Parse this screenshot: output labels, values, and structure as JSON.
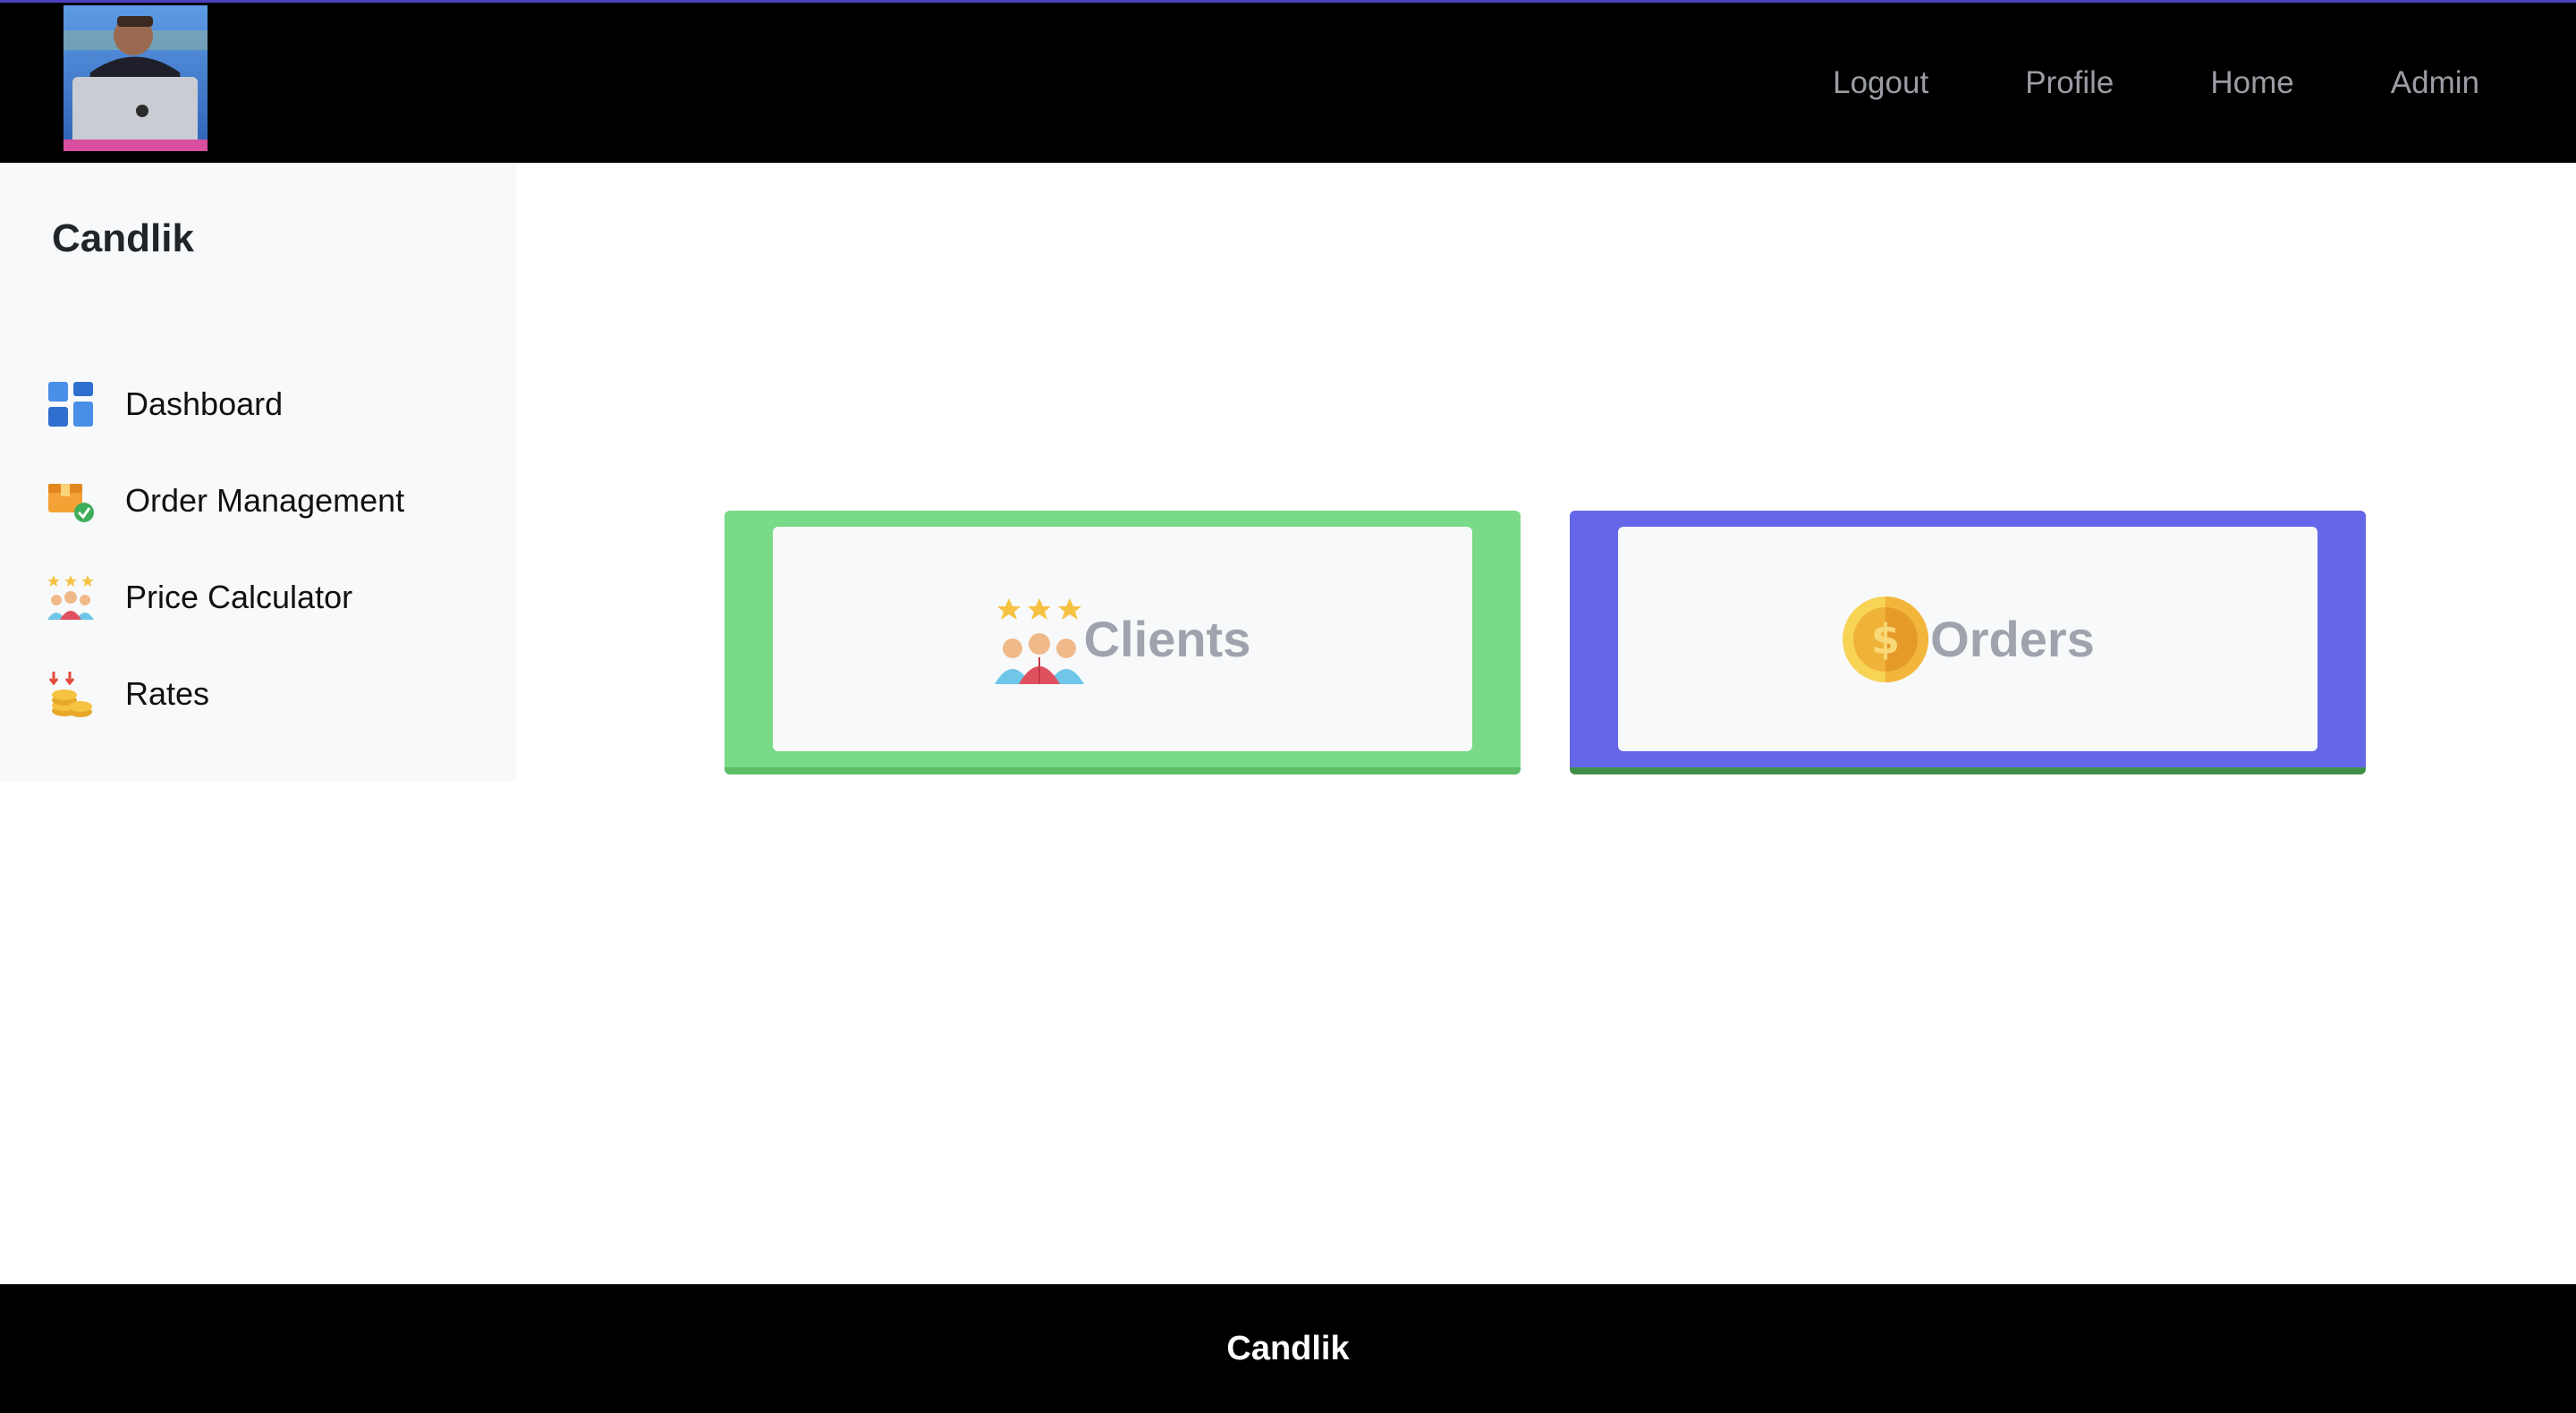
{
  "navbar": {
    "avatar_alt": "user-photo",
    "links": [
      {
        "label": "Logout"
      },
      {
        "label": "Profile"
      },
      {
        "label": "Home"
      },
      {
        "label": "Admin"
      }
    ]
  },
  "sidebar": {
    "brand": "Candlik",
    "items": [
      {
        "label": "Dashboard",
        "icon": "dashboard-icon"
      },
      {
        "label": "Order Management",
        "icon": "order-box-icon"
      },
      {
        "label": "Price Calculator",
        "icon": "people-stars-icon"
      },
      {
        "label": "Rates",
        "icon": "coins-icon"
      }
    ]
  },
  "cards": [
    {
      "label": "Clients",
      "icon": "clients-icon",
      "color": "#79da87"
    },
    {
      "label": "Orders",
      "icon": "dollar-coin-icon",
      "color": "#6667e8"
    }
  ],
  "footer": {
    "text": "Candlik"
  },
  "colors": {
    "navbar_bg": "#000000",
    "sidebar_bg": "#f8f9fa",
    "clients_card": "#79da87",
    "orders_card": "#6667e8",
    "muted_text": "#9ea3ad"
  }
}
